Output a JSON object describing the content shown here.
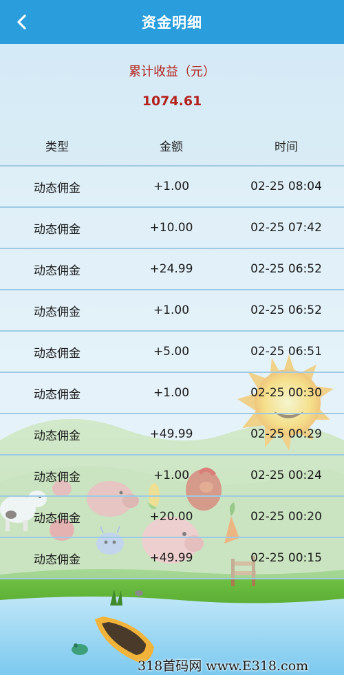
{
  "header": {
    "title": "资金明细",
    "back_icon": "chevron-left-icon"
  },
  "summary": {
    "label": "累计收益（元）",
    "value": "1074.61"
  },
  "table": {
    "columns": [
      "类型",
      "金额",
      "时间"
    ],
    "rows": [
      {
        "type": "动态佣金",
        "amount": "+1.00",
        "time": "02-25 08:04"
      },
      {
        "type": "动态佣金",
        "amount": "+10.00",
        "time": "02-25 07:42"
      },
      {
        "type": "动态佣金",
        "amount": "+24.99",
        "time": "02-25 06:52"
      },
      {
        "type": "动态佣金",
        "amount": "+1.00",
        "time": "02-25 06:52"
      },
      {
        "type": "动态佣金",
        "amount": "+5.00",
        "time": "02-25 06:51"
      },
      {
        "type": "动态佣金",
        "amount": "+1.00",
        "time": "02-25 00:30"
      },
      {
        "type": "动态佣金",
        "amount": "+49.99",
        "time": "02-25 00:29"
      },
      {
        "type": "动态佣金",
        "amount": "+1.00",
        "time": "02-25 00:24"
      },
      {
        "type": "动态佣金",
        "amount": "+20.00",
        "time": "02-25 00:20"
      },
      {
        "type": "动态佣金",
        "amount": "+49.99",
        "time": "02-25 00:15"
      }
    ]
  },
  "watermark": "318首码网 www.E318.com",
  "colors": {
    "header": "#2a9ddc",
    "accent_red": "#b3211c",
    "sky": "#d8ecf6"
  }
}
